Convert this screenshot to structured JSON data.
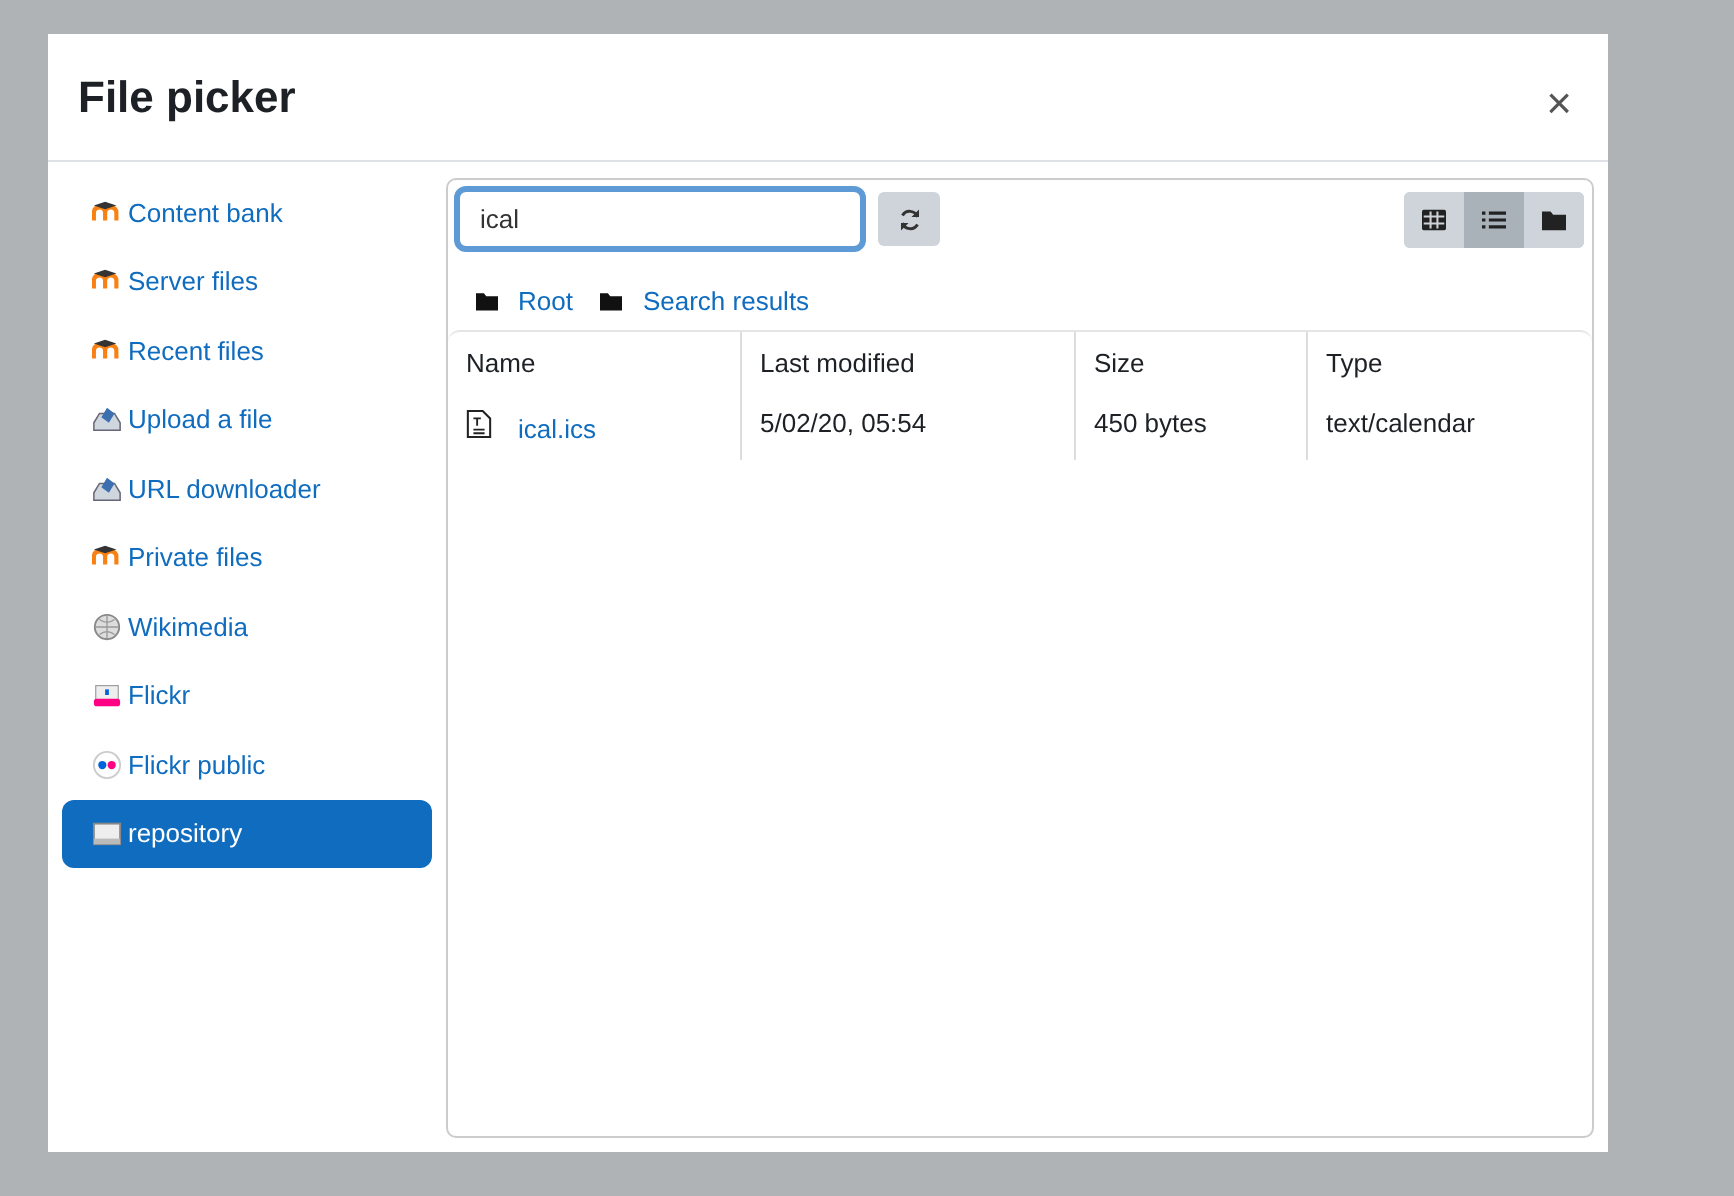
{
  "dialog": {
    "title": "File picker",
    "close": "×"
  },
  "sidebar": {
    "items": [
      {
        "label": "Content bank",
        "kind": "moodle",
        "selected": false
      },
      {
        "label": "Server files",
        "kind": "moodle",
        "selected": false
      },
      {
        "label": "Recent files",
        "kind": "moodle",
        "selected": false
      },
      {
        "label": "Upload a file",
        "kind": "upload",
        "selected": false
      },
      {
        "label": "URL downloader",
        "kind": "upload",
        "selected": false
      },
      {
        "label": "Private files",
        "kind": "moodle",
        "selected": false
      },
      {
        "label": "Wikimedia",
        "kind": "wikimedia",
        "selected": false
      },
      {
        "label": "Flickr",
        "kind": "flickr",
        "selected": false
      },
      {
        "label": "Flickr public",
        "kind": "flickr-public",
        "selected": false
      },
      {
        "label": "repository",
        "kind": "repository",
        "selected": true
      }
    ]
  },
  "toolbar": {
    "search": {
      "value": "ical"
    },
    "views": [
      {
        "kind": "grid",
        "selected": false
      },
      {
        "kind": "list",
        "selected": true
      },
      {
        "kind": "folder",
        "selected": false
      }
    ]
  },
  "breadcrumb": [
    "Root",
    "Search results"
  ],
  "table": {
    "columns": [
      "Name",
      "Last modified",
      "Size",
      "Type"
    ],
    "rows": [
      {
        "cells": [
          "ical.ics",
          "5/02/20, 05:54",
          "450 bytes",
          "text/calendar"
        ]
      }
    ]
  }
}
